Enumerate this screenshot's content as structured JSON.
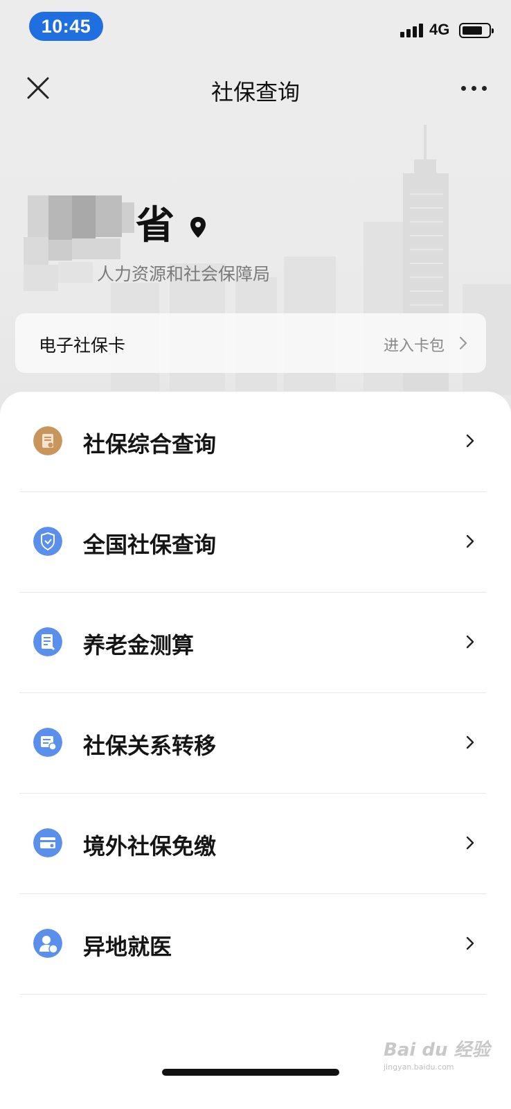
{
  "status_bar": {
    "time": "10:45",
    "network": "4G"
  },
  "nav": {
    "title": "社保查询"
  },
  "location": {
    "province": "省",
    "bureau": "人力资源和社会保障局"
  },
  "ecard": {
    "label": "电子社保卡",
    "link_label": "进入卡包"
  },
  "menu": [
    {
      "label": "社保综合查询",
      "icon": "document-icon",
      "color": "#c8965c"
    },
    {
      "label": "全国社保查询",
      "icon": "shield-icon",
      "color": "#5b8fec"
    },
    {
      "label": "养老金测算",
      "icon": "calculator-icon",
      "color": "#5b8fec"
    },
    {
      "label": "社保关系转移",
      "icon": "transfer-icon",
      "color": "#5b8fec"
    },
    {
      "label": "境外社保免缴",
      "icon": "card-icon",
      "color": "#5b8fec"
    },
    {
      "label": "异地就医",
      "icon": "person-icon",
      "color": "#5b8fec"
    }
  ],
  "watermark": {
    "text": "Bai du 经验",
    "sub": "jingyan.baidu.com"
  }
}
